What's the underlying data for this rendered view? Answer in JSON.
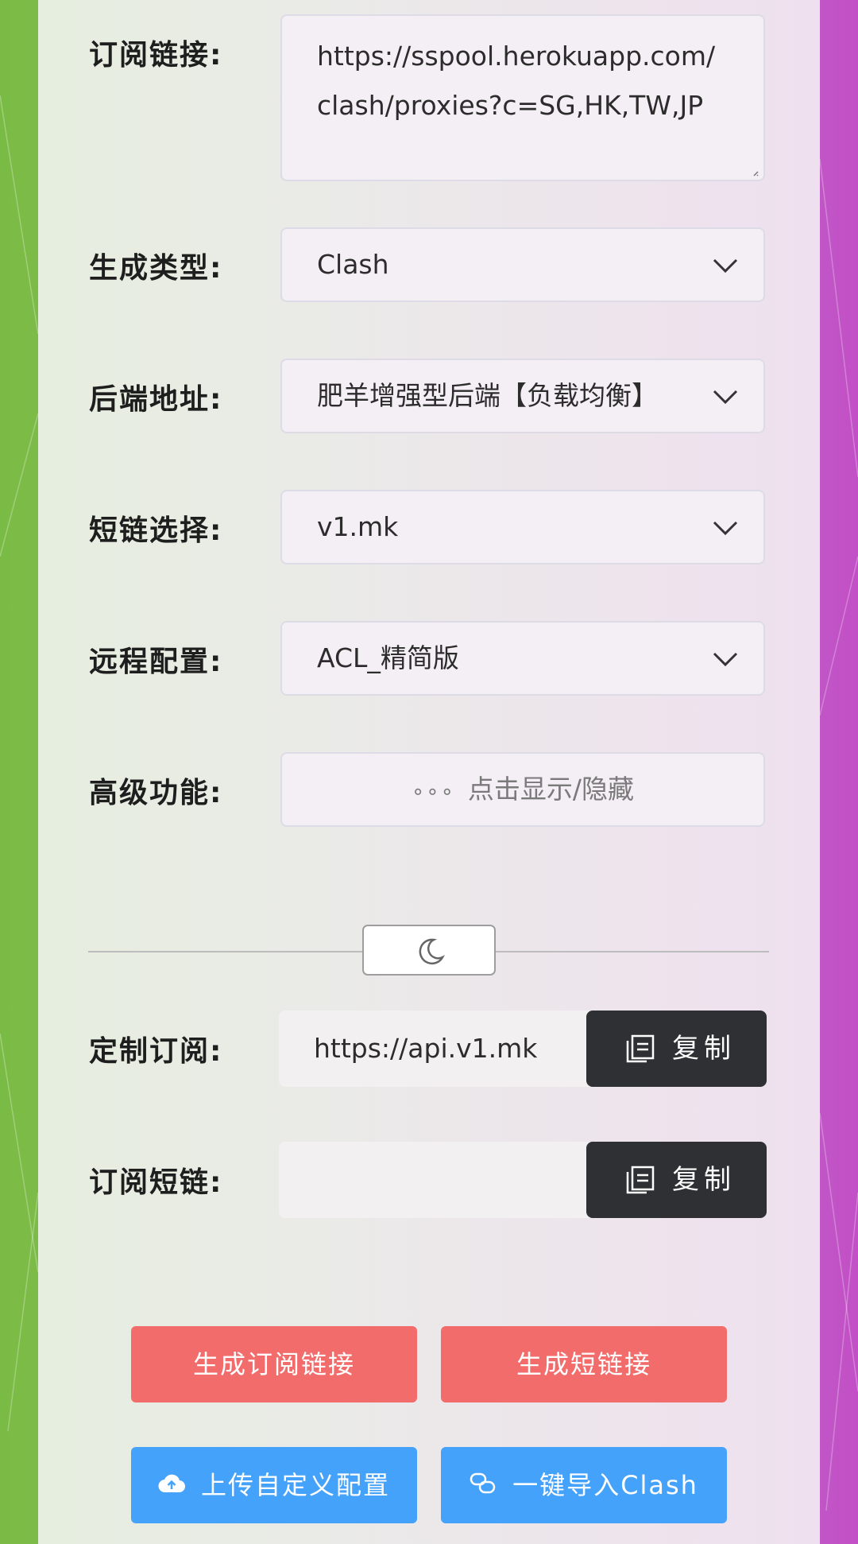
{
  "form": {
    "subscription": {
      "label": "订阅链接:",
      "value": "https://sspool.herokuapp.com/clash/proxies?c=SG,HK,TW,JP"
    },
    "target_type": {
      "label": "生成类型:",
      "selected": "Clash"
    },
    "backend": {
      "label": "后端地址:",
      "selected": "肥羊增强型后端【负载均衡】"
    },
    "short_link_service": {
      "label": "短链选择:",
      "selected": "v1.mk"
    },
    "remote_config": {
      "label": "远程配置:",
      "selected": "ACL_精简版"
    },
    "advanced": {
      "label": "高级功能:",
      "toggle_text": "点击显示/隐藏"
    }
  },
  "theme_toggle": {
    "icon": "moon-icon"
  },
  "results": {
    "custom_subscription": {
      "label": "定制订阅:",
      "value": "https://api.v1.mk",
      "copy_label": "复制"
    },
    "short_subscription": {
      "label": "订阅短链:",
      "value": "",
      "copy_label": "复制"
    }
  },
  "actions": {
    "generate_link": "生成订阅链接",
    "generate_short": "生成短链接",
    "upload_config": "上传自定义配置",
    "import_clash": "一键导入Clash"
  },
  "colors": {
    "accent_red": "#f36c6c",
    "accent_blue": "#44a2fb",
    "dark_button": "#2f3033",
    "left_edge": "#7abb45",
    "right_edge": "#c24fc6"
  }
}
